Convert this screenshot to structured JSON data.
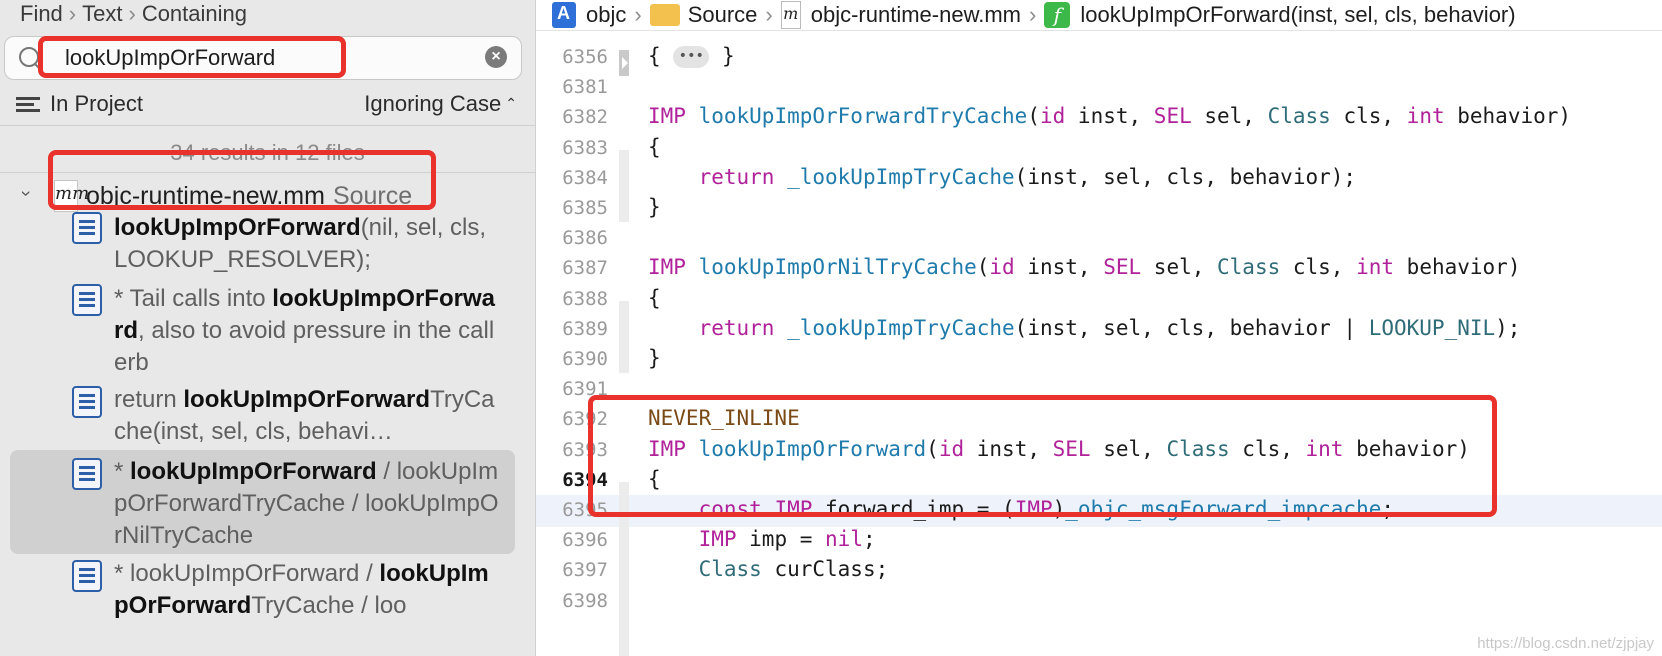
{
  "navigator": {
    "crumbs": [
      "Find",
      "Text",
      "Containing"
    ],
    "search_value": "lookUpImpOrForward",
    "scope_label": "In Project",
    "case_label": "Ignoring Case",
    "summary": "34 results in 12 files",
    "file": {
      "name": "objc-runtime-new.mm",
      "folder": "Source",
      "icon": "mm"
    },
    "results": [
      {
        "before": "",
        "match": "lookUpImpOrForward",
        "after": "(nil, sel, cls, LOOKUP_RESOLVER);"
      },
      {
        "before": "* Tail calls into ",
        "match": "lookUpImpOrForward",
        "after": ", also to avoid pressure in the callerb"
      },
      {
        "before": "return ",
        "match": "lookUpImpOrForward",
        "after": "TryCache(inst, sel, cls, behavi…"
      },
      {
        "before": "* ",
        "match": "lookUpImpOrForward",
        "after": " / lookUpImpOrForwardTryCache / lookUpImpOrNilTryCache",
        "selected": true
      },
      {
        "before": "* lookUpImpOrForward / ",
        "match": "lookUpImpOrForward",
        "after": "TryCache / loo"
      }
    ]
  },
  "editor": {
    "jump_bar": [
      "objc",
      "Source",
      "objc-runtime-new.mm",
      "lookUpImpOrForward(inst, sel, cls, behavior)"
    ],
    "current_line": "6394",
    "lines": [
      {
        "no": "6356",
        "code": "folded"
      },
      {
        "no": "6381",
        "code": ""
      },
      {
        "no": "6382",
        "code": "IMP lookUpImpOrForwardTryCache(id inst, SEL sel, Class cls, int behavior)"
      },
      {
        "no": "6383",
        "code": "{"
      },
      {
        "no": "6384",
        "code": "    return _lookUpImpTryCache(inst, sel, cls, behavior);"
      },
      {
        "no": "6385",
        "code": "}"
      },
      {
        "no": "6386",
        "code": ""
      },
      {
        "no": "6387",
        "code": "IMP lookUpImpOrNilTryCache(id inst, SEL sel, Class cls, int behavior)"
      },
      {
        "no": "6388",
        "code": "{"
      },
      {
        "no": "6389",
        "code": "    return _lookUpImpTryCache(inst, sel, cls, behavior | LOOKUP_NIL);"
      },
      {
        "no": "6390",
        "code": "}"
      },
      {
        "no": "6391",
        "code": ""
      },
      {
        "no": "6392",
        "code": "NEVER_INLINE"
      },
      {
        "no": "6393",
        "code": "IMP lookUpImpOrForward(id inst, SEL sel, Class cls, int behavior)"
      },
      {
        "no": "6394",
        "code": "{"
      },
      {
        "no": "6395",
        "code": "    const IMP forward_imp = (IMP)_objc_msgForward_impcache;"
      },
      {
        "no": "6396",
        "code": "    IMP imp = nil;"
      },
      {
        "no": "6397",
        "code": "    Class curClass;"
      },
      {
        "no": "6398",
        "code": ""
      }
    ]
  },
  "watermark": "https://blog.csdn.net/zjpjay",
  "colors": {
    "annotation_red": "#e8322b",
    "keyword": "#b0219a",
    "function": "#1f7bab",
    "type": "#2f6c78",
    "macro": "#7a4a16"
  }
}
